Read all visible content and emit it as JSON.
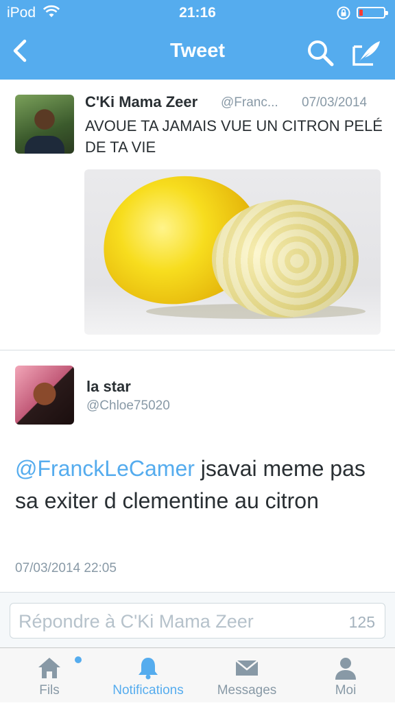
{
  "status_bar": {
    "carrier": "iPod",
    "time": "21:16",
    "battery_level": 0.15
  },
  "nav": {
    "title": "Tweet"
  },
  "original_tweet": {
    "name": "C'Ki Mama Zeer",
    "handle": "@Franc...",
    "date": "07/03/2014",
    "text": "AVOUE TA JAMAIS VUE UN CITRON PELÉ DE TA VIE"
  },
  "reply_tweet": {
    "name": "la star",
    "handle": "@Chloe75020",
    "mention": "@FranckLeCamer",
    "text": " jsavai meme pas sa exiter d clementine au citron",
    "timestamp": "07/03/2014 22:05"
  },
  "reply_bar": {
    "placeholder": "Répondre à C'Ki Mama Zeer",
    "char_count": "125"
  },
  "tabs": [
    {
      "label": "Fils",
      "icon": "home-icon"
    },
    {
      "label": "Notifications",
      "icon": "bell-icon",
      "active": true
    },
    {
      "label": "Messages",
      "icon": "envelope-icon"
    },
    {
      "label": "Moi",
      "icon": "person-icon"
    }
  ],
  "colors": {
    "accent": "#55acee",
    "text": "#292f33",
    "muted": "#8899a6",
    "battery_low": "#ff3b30"
  }
}
